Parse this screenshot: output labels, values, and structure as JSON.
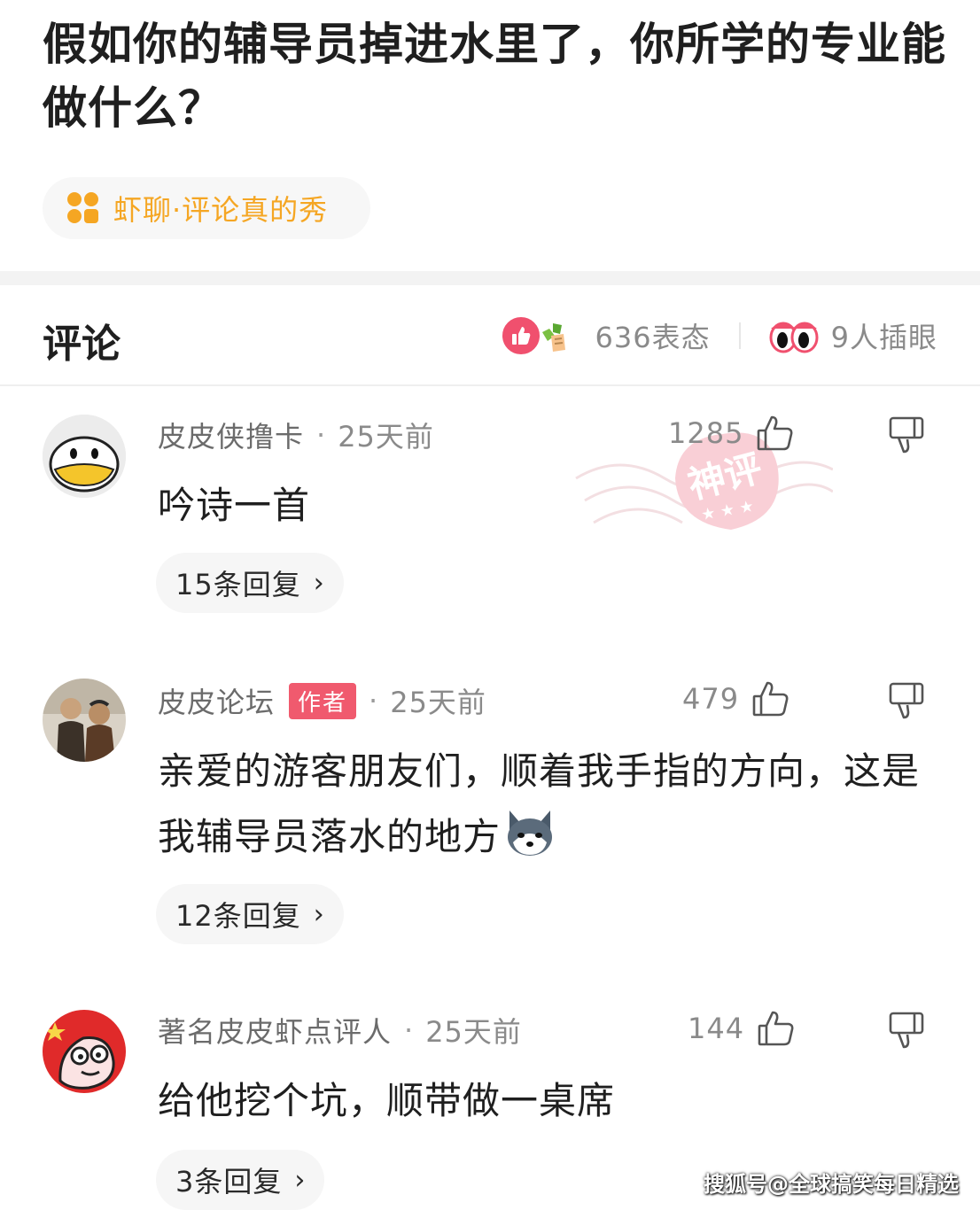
{
  "post": {
    "title": "假如你的辅导员掉进水里了，你所学的专业能做什么？",
    "topic": "虾聊·评论真的秀"
  },
  "comments_header": {
    "title": "评论",
    "reactions": "636表态",
    "watchers": "9人插眼"
  },
  "comments": [
    {
      "username": "皮皮侠撸卡",
      "separator": "·",
      "time": "25天前",
      "likes": "1285",
      "text": "吟诗一首",
      "replies": "15条回复",
      "stamp": "神评"
    },
    {
      "username": "皮皮论坛",
      "badge": "作者",
      "separator": "·",
      "time": "25天前",
      "likes": "479",
      "text": "亲爱的游客朋友们，顺着我手指的方向，这是我辅导员落水的地方",
      "replies": "12条回复"
    },
    {
      "username": "著名皮皮虾点评人",
      "separator": "·",
      "time": "25天前",
      "likes": "144",
      "text": "给他挖个坑，顺带做一桌席",
      "replies": "3条回复"
    }
  ],
  "chevron": "›",
  "watermark": "搜狐号@全球搞笑每日精选",
  "colors": {
    "accent_orange": "#f5a623",
    "like_red": "#f0506e",
    "author_badge": "#f05a6e"
  },
  "icons": [
    "topic-icon",
    "like-icon",
    "cheers-icon",
    "eyes-icon",
    "thumb-up-icon",
    "thumb-down-icon",
    "husky-emoji"
  ]
}
